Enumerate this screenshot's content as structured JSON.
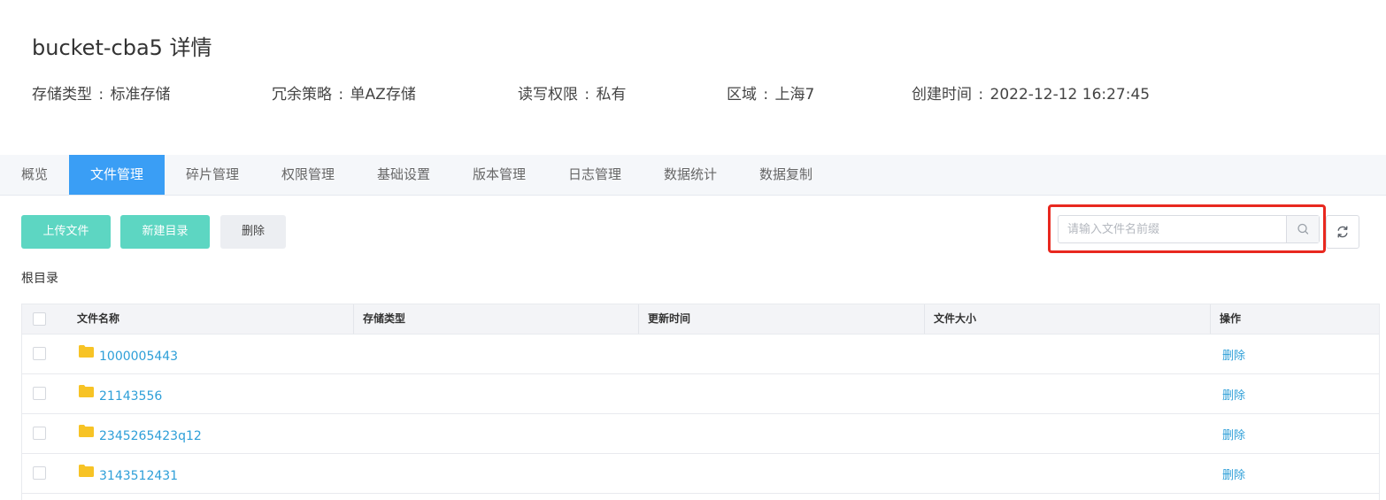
{
  "header": {
    "title": "bucket-cba5 详情",
    "meta": [
      {
        "label": "存储类型",
        "value": "标准存储"
      },
      {
        "label": "冗余策略",
        "value": "单AZ存储"
      },
      {
        "label": "读写权限",
        "value": "私有"
      },
      {
        "label": "区域",
        "value": "上海7"
      },
      {
        "label": "创建时间",
        "value": "2022-12-12 16:27:45"
      }
    ],
    "meta_separator": ":"
  },
  "tabs": [
    {
      "label": "概览",
      "active": false
    },
    {
      "label": "文件管理",
      "active": true
    },
    {
      "label": "碎片管理",
      "active": false
    },
    {
      "label": "权限管理",
      "active": false
    },
    {
      "label": "基础设置",
      "active": false
    },
    {
      "label": "版本管理",
      "active": false
    },
    {
      "label": "日志管理",
      "active": false
    },
    {
      "label": "数据统计",
      "active": false
    },
    {
      "label": "数据复制",
      "active": false
    }
  ],
  "toolbar": {
    "upload_label": "上传文件",
    "new_dir_label": "新建目录",
    "delete_label": "删除",
    "search_placeholder": "请输入文件名前缀"
  },
  "breadcrumb": "根目录",
  "table": {
    "columns": [
      "文件名称",
      "存储类型",
      "更新时间",
      "文件大小",
      "操作"
    ],
    "rows": [
      {
        "name": "1000005443",
        "storage_type": "",
        "updated": "",
        "size": "",
        "action": "删除"
      },
      {
        "name": "21143556",
        "storage_type": "",
        "updated": "",
        "size": "",
        "action": "删除"
      },
      {
        "name": "2345265423q12",
        "storage_type": "",
        "updated": "",
        "size": "",
        "action": "删除"
      },
      {
        "name": "3143512431",
        "storage_type": "",
        "updated": "",
        "size": "",
        "action": "删除"
      }
    ]
  },
  "colors": {
    "accent": "#3a9ef5",
    "primary_button": "#5dd6c2",
    "link": "#2e9fd8",
    "folder": "#f7c325",
    "highlight": "#e8281f"
  },
  "icons": {
    "search": "search-icon",
    "refresh": "refresh-icon",
    "folder": "folder-icon"
  }
}
